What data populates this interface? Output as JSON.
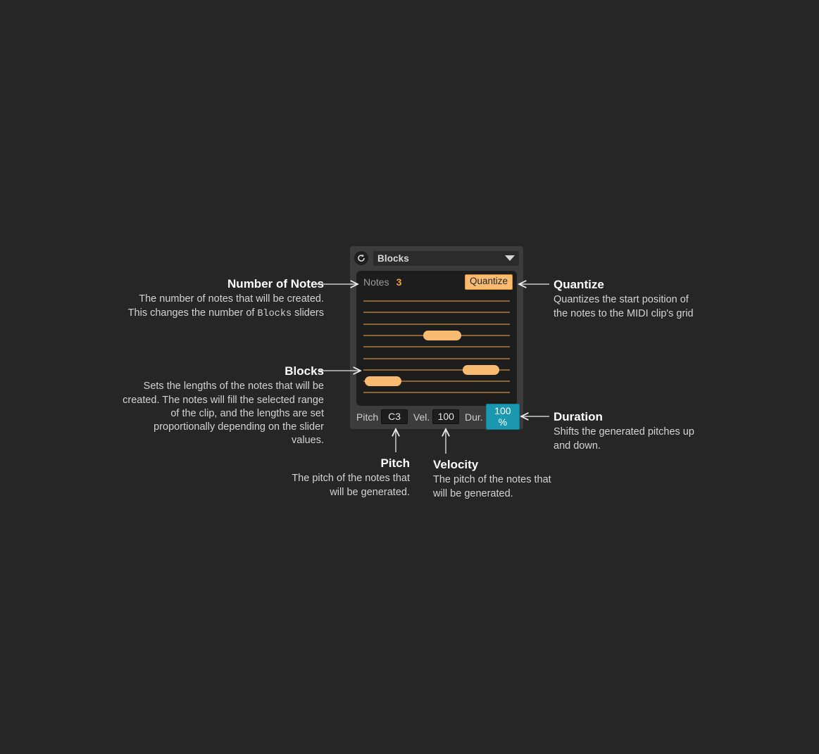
{
  "device": {
    "reset_icon": "reset-circular-arrow-icon",
    "preset_name": "Blocks",
    "dropdown_icon": "chevron-down-icon",
    "notes_label": "Notes",
    "notes_value": "3",
    "quantize_label": "Quantize",
    "sliders": [
      {
        "index": 1,
        "thumb": false
      },
      {
        "index": 2,
        "thumb": false
      },
      {
        "index": 3,
        "thumb": false
      },
      {
        "index": 4,
        "thumb": true,
        "start_pct": 41,
        "width_pct": 26
      },
      {
        "index": 5,
        "thumb": false
      },
      {
        "index": 6,
        "thumb": false
      },
      {
        "index": 7,
        "thumb": true,
        "start_pct": 68,
        "width_pct": 25
      },
      {
        "index": 8,
        "thumb": true,
        "start_pct": 1,
        "width_pct": 25
      },
      {
        "index": 9,
        "thumb": false
      }
    ],
    "params": [
      {
        "label": "Pitch",
        "value": "C3",
        "highlight": false
      },
      {
        "label": "Vel.",
        "value": "100",
        "highlight": false
      },
      {
        "label": "Dur.",
        "value": "100 %",
        "highlight": true
      }
    ]
  },
  "annotations": {
    "number_of_notes": {
      "title": "Number of Notes",
      "body_1": "The number of notes that will be created. This changes the number of ",
      "body_mono": "Blocks",
      "body_2": " sliders"
    },
    "blocks": {
      "title": "Blocks",
      "body": "Sets the lengths of the notes that will be created. The notes will fill the selected range of the clip, and the lengths are set proportionally depending on  the slider values."
    },
    "quantize": {
      "title": "Quantize",
      "body": "Quantizes the start position of the notes to the MIDI clip's grid"
    },
    "duration": {
      "title": "Duration",
      "body": "Shifts the generated pitches up and down."
    },
    "pitch": {
      "title": "Pitch",
      "body": "The pitch of the notes that will be generated."
    },
    "velocity": {
      "title": "Velocity",
      "body": "The pitch of the notes that will be generated."
    }
  },
  "colors": {
    "page_background": "#262626",
    "panel_background": "#3c3c3c",
    "inner_background": "#1d1d1d",
    "accent_orange": "#f8bb71",
    "track_orange": "#8a6332",
    "value_orange": "#f0a33c",
    "highlight_teal": "#1b98b0",
    "text_primary": "#ffffff",
    "text_secondary": "#d3d3d3"
  }
}
